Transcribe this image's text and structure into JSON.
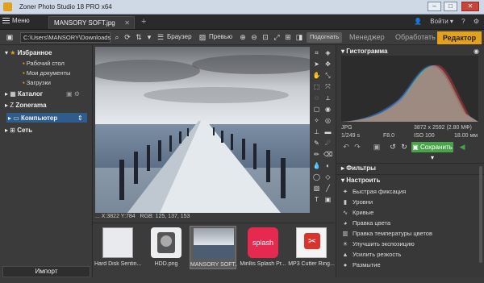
{
  "window": {
    "title": "Zoner Photo Studio 18 PRO x64",
    "btn_min": "–",
    "btn_max": "□",
    "btn_close": "✕"
  },
  "menubar": {
    "menu_label": "Меню",
    "doc_tab": "MANSORY SOFT.jpg",
    "add_tab": "+",
    "login": "Войти ▾"
  },
  "toolbar": {
    "path": "C:\\Users\\MANSORY\\Downloads",
    "browser_label": "Браузер",
    "preview_label": "Превью",
    "fit_label": "Подогнать"
  },
  "modes": {
    "manager": "Менеджер",
    "develop": "Обработать",
    "editor": "Редактор"
  },
  "sidebar": {
    "favorites": "Избранное",
    "fav_items": [
      "Рабочий стол",
      "Мои документы",
      "Загрузки"
    ],
    "catalog": "Каталог",
    "zonerama": "Zonerama",
    "computer": "Компьютер",
    "network": "Сеть",
    "import": "Импорт"
  },
  "status": {
    "coords": "... X:3822 Y:784",
    "rgb": "RGB: 125, 137, 153"
  },
  "filmstrip": [
    {
      "caption": "Hard Disk Sentin..."
    },
    {
      "caption": "HDD.png"
    },
    {
      "caption": "MANSORY SOFT...."
    },
    {
      "caption": "Mirillis Splash Pr..."
    },
    {
      "caption": "MP3 Cutter Ring..."
    }
  ],
  "right": {
    "histogram_title": "Гистограмма",
    "format": "JPG",
    "dimensions": "3872 x 2592 (2.80 МФ)",
    "shutter": "1/249 s",
    "aperture": "F8.0",
    "iso": "ISO 100",
    "focal": "18.00 мм",
    "save_label": "Сохранить",
    "filters_title": "Фильтры",
    "adjust_title": "Настроить",
    "tools": [
      "Быстрая фиксация",
      "Уровни",
      "Кривые",
      "Правка цвета",
      "Правка температуры цветов",
      "Улучшить экспозицию",
      "Усилить резкость",
      "Размытие"
    ]
  },
  "colors": {
    "accent": "#e4a11b",
    "save": "#49a34a",
    "selection": "#2f5c8a"
  }
}
